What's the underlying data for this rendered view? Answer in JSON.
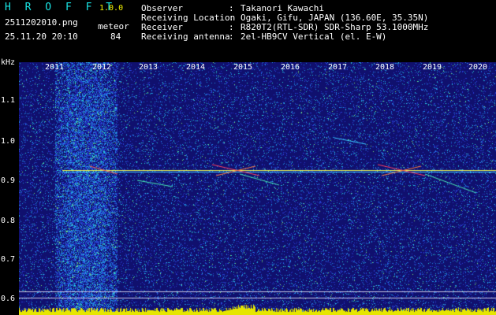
{
  "app": {
    "name": "H R O F F T",
    "version": "1.0.0",
    "filename": "2511202010.png",
    "datetime": "25.11.20 20:10"
  },
  "meteor": {
    "label": "meteor",
    "count": "84"
  },
  "info": [
    {
      "label": "Observer",
      "value": "Takanori Kawachi"
    },
    {
      "label": "Receiving Location",
      "value": "Ogaki, Gifu, JAPAN (136.60E, 35.35N)"
    },
    {
      "label": "Receiver",
      "value": "R820T2(RTL-SDR) SDR-Sharp 53.1000MHz"
    },
    {
      "label": "Receiving antenna",
      "value": "2el-HB9CV Vertical (el. E-W)"
    }
  ],
  "info_separator": ":",
  "yaxis": {
    "unit": "kHz",
    "ticks": [
      "1.1",
      "1.0",
      "0.9",
      "0.8",
      "0.7",
      "0.6"
    ]
  },
  "xaxis": {
    "ticks": [
      "2011",
      "2012",
      "2013",
      "2014",
      "2015",
      "2016",
      "2017",
      "2018",
      "2019",
      "2020"
    ]
  },
  "colors": {
    "header_cyan": "#19e6e6",
    "header_yellow": "#f2f200",
    "background": "#10106e",
    "carrier": "#e6f25a"
  }
}
